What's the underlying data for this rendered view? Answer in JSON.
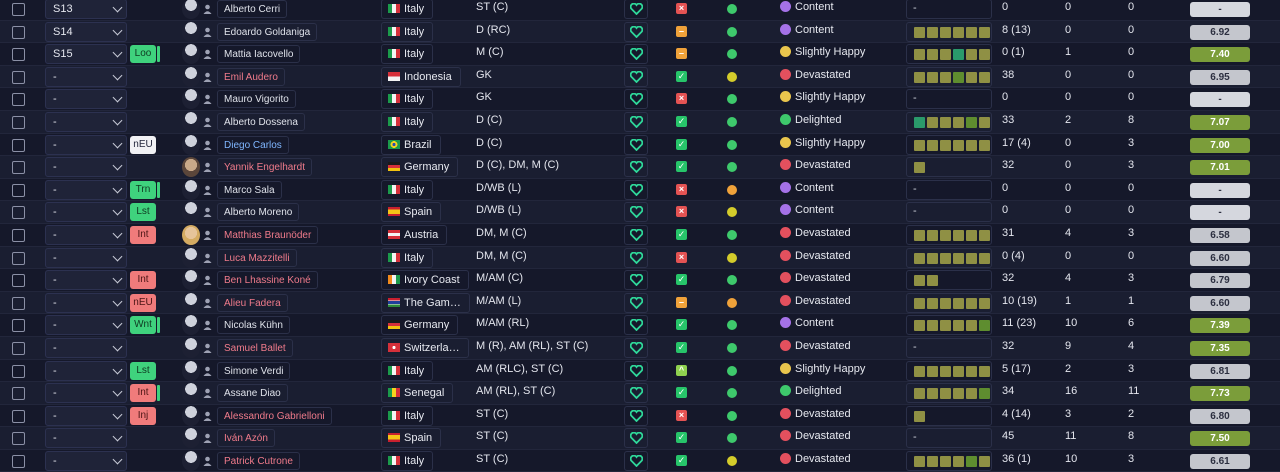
{
  "rows": [
    {
      "sel": "S13",
      "badge": "",
      "badge_color": "empty",
      "badge_bar": false,
      "face": "sil",
      "name": "Alberto Cerri",
      "name_color": "white",
      "flag": "italy",
      "nation": "Italy",
      "position": "ST (C)",
      "sq": "red",
      "sq_mark": "×",
      "dot": "g",
      "mood": "Content",
      "mood_type": "content",
      "form": [],
      "apps": "0",
      "goals": "0",
      "assists": "0",
      "rating": "-",
      "rating_type": "grey"
    },
    {
      "sel": "S14",
      "badge": "",
      "badge_color": "empty",
      "badge_bar": false,
      "face": "sil",
      "name": "Edoardo Goldaniga",
      "name_color": "white",
      "flag": "italy",
      "nation": "Italy",
      "position": "D (RC)",
      "sq": "orange",
      "sq_mark": "–",
      "dot": "g",
      "mood": "Content",
      "mood_type": "content",
      "form": [
        "k",
        "k",
        "k",
        "k",
        "k",
        "k"
      ],
      "apps": "8 (13)",
      "goals": "0",
      "assists": "0",
      "rating": "6.92",
      "rating_type": "dark"
    },
    {
      "sel": "S15",
      "badge": "Loo",
      "badge_color": "green",
      "badge_bar": true,
      "face": "sil",
      "name": "Mattia Iacovello",
      "name_color": "white",
      "flag": "italy",
      "nation": "Italy",
      "position": "M (C)",
      "sq": "orange",
      "sq_mark": "–",
      "dot": "g",
      "mood": "Slightly Happy",
      "mood_type": "happy",
      "form": [
        "k",
        "k",
        "k",
        "t",
        "k",
        "k"
      ],
      "apps": "0 (1)",
      "goals": "1",
      "assists": "0",
      "rating": "7.40",
      "rating_type": "hi"
    },
    {
      "sel": "-",
      "badge": "",
      "badge_color": "empty",
      "badge_bar": false,
      "face": "sil",
      "name": "Emil Audero",
      "name_color": "red",
      "flag": "indonesia",
      "nation": "Indonesia",
      "position": "GK",
      "sq": "green",
      "sq_mark": "✓",
      "dot": "y",
      "mood": "Devastated",
      "mood_type": "dev",
      "form": [
        "k",
        "k",
        "k",
        "gg",
        "k",
        "k"
      ],
      "apps": "38",
      "goals": "0",
      "assists": "0",
      "rating": "6.95",
      "rating_type": "dark"
    },
    {
      "sel": "-",
      "badge": "",
      "badge_color": "empty",
      "badge_bar": false,
      "face": "sil",
      "name": "Mauro Vigorito",
      "name_color": "white",
      "flag": "italy",
      "nation": "Italy",
      "position": "GK",
      "sq": "red",
      "sq_mark": "×",
      "dot": "g",
      "mood": "Slightly Happy",
      "mood_type": "happy",
      "form": [],
      "apps": "0",
      "goals": "0",
      "assists": "0",
      "rating": "-",
      "rating_type": "grey"
    },
    {
      "sel": "-",
      "badge": "",
      "badge_color": "empty",
      "badge_bar": false,
      "face": "sil",
      "name": "Alberto Dossena",
      "name_color": "white",
      "flag": "italy",
      "nation": "Italy",
      "position": "D (C)",
      "sq": "green",
      "sq_mark": "✓",
      "dot": "g",
      "mood": "Delighted",
      "mood_type": "del",
      "form": [
        "t",
        "k",
        "k",
        "k",
        "gg",
        "k"
      ],
      "apps": "33",
      "goals": "2",
      "assists": "8",
      "rating": "7.07",
      "rating_type": "hi"
    },
    {
      "sel": "-",
      "badge": "nEU",
      "badge_color": "white",
      "badge_bar": false,
      "face": "sil",
      "name": "Diego Carlos",
      "name_color": "blue",
      "flag": "brazil",
      "nation": "Brazil",
      "position": "D (C)",
      "sq": "green",
      "sq_mark": "✓",
      "dot": "g",
      "mood": "Slightly Happy",
      "mood_type": "happy",
      "form": [
        "k",
        "k",
        "k",
        "k",
        "k",
        "k"
      ],
      "apps": "17 (4)",
      "goals": "0",
      "assists": "3",
      "rating": "7.00",
      "rating_type": "hi"
    },
    {
      "sel": "-",
      "badge": "",
      "badge_color": "empty",
      "badge_bar": false,
      "face": "photo",
      "name": "Yannik Engelhardt",
      "name_color": "red",
      "flag": "germany",
      "nation": "Germany",
      "position": "D (C), DM, M (C)",
      "sq": "green",
      "sq_mark": "✓",
      "dot": "g",
      "mood": "Devastated",
      "mood_type": "dev",
      "form": [
        "k"
      ],
      "apps": "32",
      "goals": "0",
      "assists": "3",
      "rating": "7.01",
      "rating_type": "hi"
    },
    {
      "sel": "-",
      "badge": "Trn",
      "badge_color": "green",
      "badge_bar": true,
      "face": "sil",
      "name": "Marco Sala",
      "name_color": "white",
      "flag": "italy",
      "nation": "Italy",
      "position": "D/WB (L)",
      "sq": "red",
      "sq_mark": "×",
      "dot": "o",
      "mood": "Content",
      "mood_type": "content",
      "form": [],
      "apps": "0",
      "goals": "0",
      "assists": "0",
      "rating": "-",
      "rating_type": "grey"
    },
    {
      "sel": "-",
      "badge": "Lst",
      "badge_color": "green",
      "badge_bar": false,
      "face": "sil",
      "name": "Alberto Moreno",
      "name_color": "white",
      "flag": "spain",
      "nation": "Spain",
      "position": "D/WB (L)",
      "sq": "red",
      "sq_mark": "×",
      "dot": "y",
      "mood": "Content",
      "mood_type": "content",
      "form": [],
      "apps": "0",
      "goals": "0",
      "assists": "0",
      "rating": "-",
      "rating_type": "grey"
    },
    {
      "sel": "-",
      "badge": "Int",
      "badge_color": "red",
      "badge_bar": false,
      "face": "photo2",
      "name": "Matthias Braunöder",
      "name_color": "red",
      "flag": "austria",
      "nation": "Austria",
      "position": "DM, M (C)",
      "sq": "green",
      "sq_mark": "✓",
      "dot": "g",
      "mood": "Devastated",
      "mood_type": "dev",
      "form": [
        "k",
        "k",
        "k",
        "k",
        "k",
        "k"
      ],
      "apps": "31",
      "goals": "4",
      "assists": "3",
      "rating": "6.58",
      "rating_type": "dark"
    },
    {
      "sel": "-",
      "badge": "",
      "badge_color": "empty",
      "badge_bar": false,
      "face": "sil",
      "name": "Luca Mazzitelli",
      "name_color": "red",
      "flag": "italy",
      "nation": "Italy",
      "position": "DM, M (C)",
      "sq": "red",
      "sq_mark": "×",
      "dot": "y",
      "mood": "Devastated",
      "mood_type": "dev",
      "form": [
        "k",
        "k",
        "k",
        "k",
        "k",
        "k"
      ],
      "apps": "0 (4)",
      "goals": "0",
      "assists": "0",
      "rating": "6.60",
      "rating_type": "dark"
    },
    {
      "sel": "-",
      "badge": "Int",
      "badge_color": "red",
      "badge_bar": false,
      "face": "sil",
      "name": "Ben Lhassine Koné",
      "name_color": "red",
      "flag": "ivory",
      "nation": "Ivory Coast",
      "position": "M/AM (C)",
      "sq": "green",
      "sq_mark": "✓",
      "dot": "g",
      "mood": "Devastated",
      "mood_type": "dev",
      "form": [
        "k",
        "k"
      ],
      "apps": "32",
      "goals": "4",
      "assists": "3",
      "rating": "6.79",
      "rating_type": "dark"
    },
    {
      "sel": "-",
      "badge": "nEU",
      "badge_color": "red",
      "badge_bar": false,
      "face": "sil",
      "name": "Alieu Fadera",
      "name_color": "red",
      "flag": "gambia",
      "nation": "The Gam…",
      "position": "M/AM (L)",
      "sq": "orange",
      "sq_mark": "–",
      "dot": "o",
      "mood": "Devastated",
      "mood_type": "dev",
      "form": [
        "k",
        "k",
        "k",
        "k",
        "k",
        "k"
      ],
      "apps": "10 (19)",
      "goals": "1",
      "assists": "1",
      "rating": "6.60",
      "rating_type": "dark"
    },
    {
      "sel": "-",
      "badge": "Wnt",
      "badge_color": "green",
      "badge_bar": true,
      "face": "sil",
      "name": "Nicolas Kühn",
      "name_color": "white",
      "flag": "germany",
      "nation": "Germany",
      "position": "M/AM (RL)",
      "sq": "green",
      "sq_mark": "✓",
      "dot": "g",
      "mood": "Content",
      "mood_type": "content",
      "form": [
        "k",
        "k",
        "k",
        "k",
        "k",
        "gg"
      ],
      "apps": "11 (23)",
      "goals": "10",
      "assists": "6",
      "rating": "7.39",
      "rating_type": "hi"
    },
    {
      "sel": "-",
      "badge": "",
      "badge_color": "empty",
      "badge_bar": false,
      "face": "sil",
      "name": "Samuel Ballet",
      "name_color": "red",
      "flag": "swiss",
      "nation": "Switzerla…",
      "position": "M (R), AM (RL), ST (C)",
      "sq": "green",
      "sq_mark": "✓",
      "dot": "g",
      "mood": "Devastated",
      "mood_type": "dev",
      "form": [],
      "apps": "32",
      "goals": "9",
      "assists": "4",
      "rating": "7.35",
      "rating_type": "hi"
    },
    {
      "sel": "-",
      "badge": "Lst",
      "badge_color": "green",
      "badge_bar": false,
      "face": "sil",
      "name": "Simone Verdi",
      "name_color": "white",
      "flag": "italy",
      "nation": "Italy",
      "position": "AM (RLC), ST (C)",
      "sq": "lime",
      "sq_mark": "^",
      "dot": "g",
      "mood": "Slightly Happy",
      "mood_type": "happy",
      "form": [
        "k",
        "k",
        "k",
        "k",
        "k",
        "k"
      ],
      "apps": "5 (17)",
      "goals": "2",
      "assists": "3",
      "rating": "6.81",
      "rating_type": "dark"
    },
    {
      "sel": "-",
      "badge": "Int",
      "badge_color": "red",
      "badge_bar": true,
      "face": "sil",
      "name": "Assane Diao",
      "name_color": "white",
      "flag": "senegal",
      "nation": "Senegal",
      "position": "AM (RL), ST (C)",
      "sq": "green",
      "sq_mark": "✓",
      "dot": "g",
      "mood": "Delighted",
      "mood_type": "del",
      "form": [
        "k",
        "k",
        "k",
        "k",
        "k",
        "gg"
      ],
      "apps": "34",
      "goals": "16",
      "assists": "11",
      "rating": "7.73",
      "rating_type": "hi"
    },
    {
      "sel": "-",
      "badge": "Inj",
      "badge_color": "red",
      "badge_bar": false,
      "face": "sil",
      "name": "Alessandro Gabrielloni",
      "name_color": "red",
      "flag": "italy",
      "nation": "Italy",
      "position": "ST (C)",
      "sq": "red",
      "sq_mark": "×",
      "dot": "g",
      "mood": "Devastated",
      "mood_type": "dev",
      "form": [
        "k"
      ],
      "apps": "4 (14)",
      "goals": "3",
      "assists": "2",
      "rating": "6.80",
      "rating_type": "dark"
    },
    {
      "sel": "-",
      "badge": "",
      "badge_color": "empty",
      "badge_bar": false,
      "face": "sil",
      "name": "Iván Azón",
      "name_color": "red",
      "flag": "spain",
      "nation": "Spain",
      "position": "ST (C)",
      "sq": "green",
      "sq_mark": "✓",
      "dot": "g",
      "mood": "Devastated",
      "mood_type": "dev",
      "form": [],
      "apps": "45",
      "goals": "11",
      "assists": "8",
      "rating": "7.50",
      "rating_type": "hi"
    },
    {
      "sel": "-",
      "badge": "",
      "badge_color": "empty",
      "badge_bar": false,
      "face": "sil",
      "name": "Patrick Cutrone",
      "name_color": "red",
      "flag": "italy",
      "nation": "Italy",
      "position": "ST (C)",
      "sq": "green",
      "sq_mark": "✓",
      "dot": "y",
      "mood": "Devastated",
      "mood_type": "dev",
      "form": [
        "k",
        "k",
        "k",
        "k",
        "gg",
        "k"
      ],
      "apps": "36 (1)",
      "goals": "10",
      "assists": "3",
      "rating": "6.61",
      "rating_type": "dark"
    }
  ]
}
